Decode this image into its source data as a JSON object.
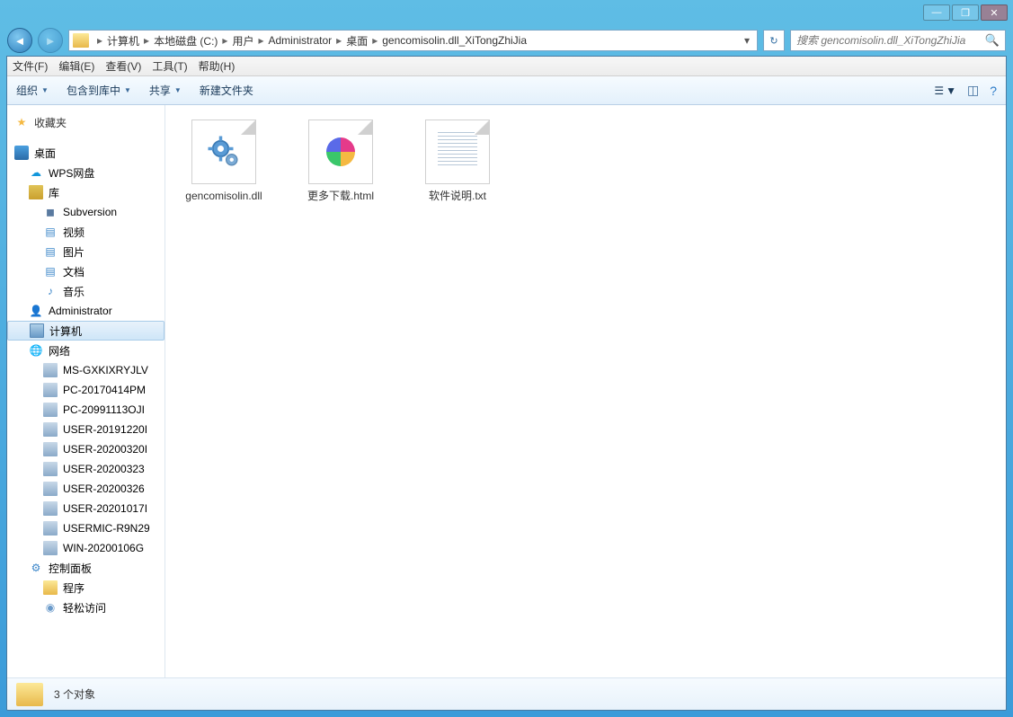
{
  "window": {
    "min": "—",
    "max_glyph": "❐",
    "close": "✕"
  },
  "breadcrumbs": [
    "计算机",
    "本地磁盘 (C:)",
    "用户",
    "Administrator",
    "桌面",
    "gencomisolin.dll_XiTongZhiJia"
  ],
  "search": {
    "placeholder": "搜索 gencomisolin.dll_XiTongZhiJia"
  },
  "menu": {
    "file": "文件(F)",
    "edit": "编辑(E)",
    "view": "查看(V)",
    "tools": "工具(T)",
    "help": "帮助(H)"
  },
  "toolbar": {
    "org": "组织",
    "include": "包含到库中",
    "share": "共享",
    "newf": "新建文件夹"
  },
  "sidebar": {
    "fav": "收藏夹",
    "desktop": "桌面",
    "wps": "WPS网盘",
    "lib": "库",
    "svn": "Subversion",
    "video": "视频",
    "pic": "图片",
    "doc": "文档",
    "music": "音乐",
    "admin": "Administrator",
    "comp": "计算机",
    "net": "网络",
    "n1": "MS-GXKIXRYJLV",
    "n2": "PC-20170414PM",
    "n3": "PC-20991113OJI",
    "n4": "USER-20191220I",
    "n5": "USER-20200320I",
    "n6": "USER-20200323",
    "n7": "USER-20200326",
    "n8": "USER-20201017I",
    "n9": "USERMIC-R9N29",
    "n10": "WIN-20200106G",
    "cp": "控制面板",
    "prog": "程序",
    "ease": "轻松访问"
  },
  "files": {
    "f1": "gencomisolin.dll",
    "f2": "更多下载.html",
    "f3": "软件说明.txt"
  },
  "status": {
    "count": "3 个对象"
  }
}
